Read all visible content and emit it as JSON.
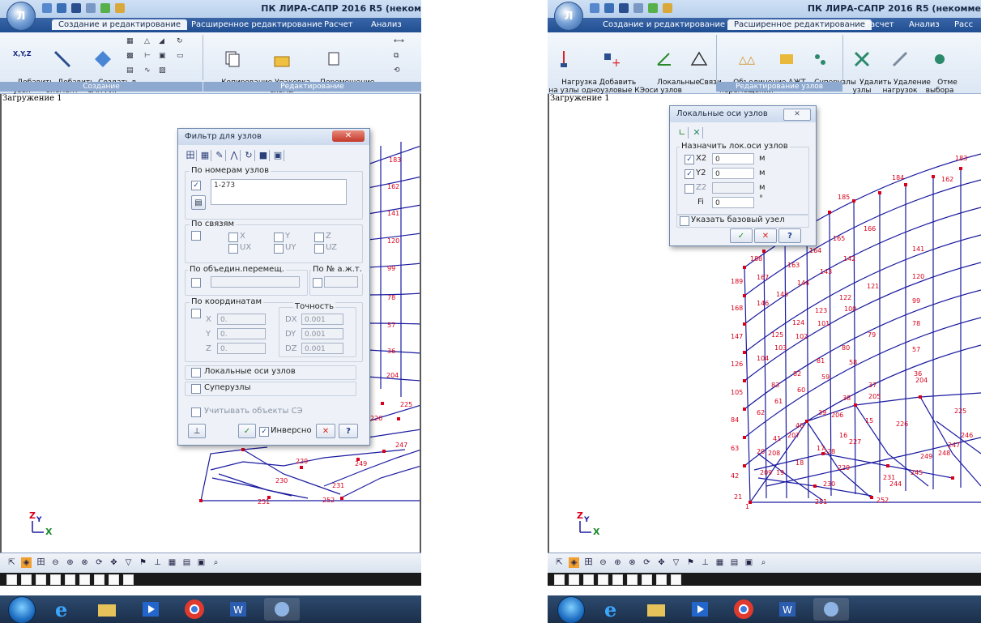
{
  "left": {
    "app_title": "ПК ЛИРА-САПР  2016 R5 (неком",
    "tabs": [
      "Создание и редактирование",
      "Расширенное редактирование",
      "Расчет",
      "Анализ"
    ],
    "ribbon": {
      "xyz_glyph": "X,Y,Z",
      "add_node": "Добавить\nузел",
      "add_element": "Добавить\nэлемент",
      "create_sapfir": "Создать в\nСАПФИР",
      "copy": "Копирование",
      "pack": "Упаковка\nсхемы",
      "move": "Перемещение",
      "group_create": "Создание",
      "group_edit": "Редактирование"
    },
    "load_case": "Загружение 1",
    "node_labels": [
      "183",
      "162",
      "141",
      "120",
      "99",
      "78",
      "57",
      "36",
      "204",
      "225",
      "226",
      "247",
      "230",
      "229",
      "231",
      "251",
      "252",
      "249"
    ],
    "filter_dialog": {
      "title": "Фильтр для узлов",
      "by_numbers_caption": "По номерам узлов",
      "by_numbers_checked": "✓",
      "by_numbers_value": "1-273",
      "by_constraints_caption": "По связям",
      "constraints": [
        "X",
        "Y",
        "Z",
        "UX",
        "UY",
        "UZ"
      ],
      "by_union_caption": "По объедин.перемещ.",
      "by_axt_caption": "По № а.ж.т.",
      "by_coords_caption": "По координатам",
      "coord_x_label": "X",
      "coord_x_value": "0.",
      "coord_y_label": "Y",
      "coord_y_value": "0.",
      "coord_z_label": "Z",
      "coord_z_value": "0.",
      "precision_caption": "Точность",
      "dx_label": "DX",
      "dx_value": "0.001",
      "dy_label": "DY",
      "dy_value": "0.001",
      "dz_label": "DZ",
      "dz_value": "0.001",
      "local_axes_label": "Локальные оси узлов",
      "supernodes_label": "Суперузлы",
      "consider_fe_label": "Учитывать объекты СЭ",
      "inverse_checked": "✓",
      "inverse_label": "Инверсно",
      "close_glyph": "✕",
      "help_glyph": "?"
    }
  },
  "right": {
    "app_title": "ПК ЛИРА-САПР  2016 R5 (некомме",
    "tabs": [
      "Создание и редактирование",
      "Расширенное редактирование",
      "Расчет",
      "Анализ",
      "Расс"
    ],
    "ribbon": {
      "node_load": "Нагрузка\nна узлы",
      "add_single_node": "Добавить\nодноузловые КЭ",
      "local_axes": "Локальные\nоси узлов",
      "constraints": "Связи",
      "union": "Объединение\nперемещений",
      "axt": "АЖТ",
      "supernodes": "Суперузлы",
      "delete_nodes": "Удалить\nузлы",
      "delete_loads": "Удаление\nнагрузок",
      "cancel_selection": "Отме\nвыбора",
      "group_edit_nodes": "Редактирование узлов"
    },
    "load_case": "Загружение 1",
    "node_labels": [
      "183",
      "184",
      "185",
      "186",
      "187",
      "188",
      "189",
      "168",
      "147",
      "126",
      "105",
      "84",
      "63",
      "42",
      "21",
      "1",
      "162",
      "163",
      "164",
      "165",
      "166",
      "167",
      "146",
      "145",
      "144",
      "143",
      "142",
      "141",
      "120",
      "121",
      "122",
      "123",
      "124",
      "125",
      "104",
      "103",
      "102",
      "101",
      "100",
      "99",
      "78",
      "79",
      "80",
      "81",
      "82",
      "83",
      "62",
      "61",
      "60",
      "59",
      "58",
      "57",
      "36",
      "37",
      "38",
      "39",
      "40",
      "41",
      "20",
      "19",
      "18",
      "17",
      "16",
      "15",
      "204",
      "205",
      "206",
      "207",
      "208",
      "209",
      "226",
      "225",
      "228",
      "229",
      "230",
      "231",
      "251",
      "252",
      "249",
      "248",
      "247",
      "246",
      "245",
      "244",
      "227"
    ],
    "local_axes_dialog": {
      "title": "Локальные оси узлов",
      "close_glyph": "✕",
      "assign_caption": "Назначить лок.оси узлов",
      "x2_checked": "✓",
      "x2_label": "X2",
      "x2_value": "0",
      "x2_unit": "м",
      "y2_checked": "✓",
      "y2_label": "Y2",
      "y2_value": "0",
      "y2_unit": "м",
      "z2_label": "Z2",
      "z2_value": "",
      "z2_unit": "м",
      "fi_label": "Fi",
      "fi_value": "0",
      "fi_unit": "°",
      "base_node_label": "Указать базовый узел",
      "ok_glyph": "✓",
      "cancel_glyph": "✕",
      "help_glyph": "?"
    }
  },
  "axis_labels": {
    "z": "Z",
    "y": "Y",
    "x": "X"
  },
  "colors": {
    "accent": "#1f4e91",
    "node": "#d8001a",
    "element": "#1a1aa0",
    "dialog_close": "#c2382a"
  }
}
